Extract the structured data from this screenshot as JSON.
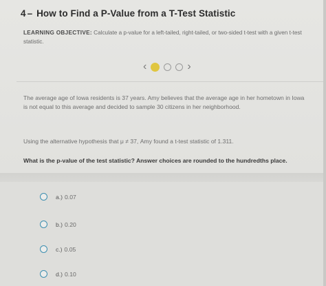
{
  "lesson": {
    "number": "4",
    "dash": "–",
    "title": "How to Find a P-Value from a T-Test Statistic"
  },
  "objective": {
    "label": "LEARNING OBJECTIVE:",
    "text": "Calculate a p-value for a left-tailed, right-tailed, or two-sided t-test with a given t-test statistic."
  },
  "pager": {
    "prev_icon": "chevron-left-icon",
    "next_icon": "chevron-right-icon",
    "total_dots": 3,
    "active_index": 0,
    "prev_glyph": "‹",
    "next_glyph": "›"
  },
  "problem": {
    "paragraph1": "The average age of Iowa residents is 37 years. Amy believes that the average age in her hometown in Iowa is not equal to this average and decided to sample 30 citizens in her neighborhood.",
    "paragraph2": "Using the alternative hypothesis that μ ≠ 37, Amy found a t-test statistic of 1.311.",
    "question": "What is the p-value of the test statistic? Answer choices are rounded to the hundredths place."
  },
  "choices": [
    {
      "letter": "a.)",
      "value": "0.07"
    },
    {
      "letter": "b.)",
      "value": "0.20"
    },
    {
      "letter": "c.)",
      "value": "0.05"
    },
    {
      "letter": "d.)",
      "value": "0.10"
    }
  ],
  "colors": {
    "accent_dot": "#e0c640",
    "radio_border": "#3d8fb0"
  }
}
